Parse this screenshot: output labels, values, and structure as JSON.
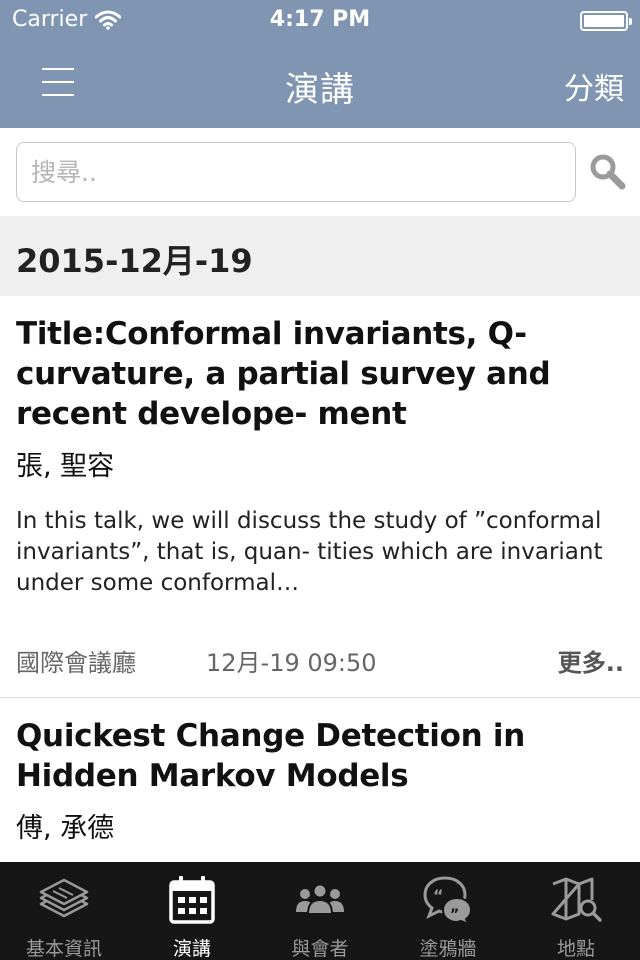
{
  "status_bar": {
    "carrier": "Carrier",
    "time": "4:17 PM"
  },
  "nav": {
    "title": "演講",
    "category_label": "分類"
  },
  "search": {
    "placeholder": "搜尋.."
  },
  "list": {
    "date": "2015-12月-19",
    "items": [
      {
        "title": "Title:Conformal invariants, Q-curvature, a partial survey and recent develope- ment",
        "speaker": "張, 聖容",
        "abstract": "In this talk, we will discuss the study of ”conformal invariants”, that is, quan- tities which are invariant under some conformal…",
        "location": "國際會議廳",
        "time": "12月-19 09:50",
        "more_label": "更多.."
      },
      {
        "title": "Quickest Change Detection in Hidden Markov Models",
        "speaker": "傅, 承德"
      }
    ]
  },
  "tabs": [
    {
      "label": "基本資訊",
      "icon": "newspaper-icon",
      "active": false
    },
    {
      "label": "演講",
      "icon": "calendar-icon",
      "active": true
    },
    {
      "label": "與會者",
      "icon": "people-icon",
      "active": false
    },
    {
      "label": "塗鴉牆",
      "icon": "chat-bubbles-icon",
      "active": false
    },
    {
      "label": "地點",
      "icon": "map-icon",
      "active": false
    }
  ],
  "colors": {
    "header_bg": "#7f95b2",
    "tab_bar_bg": "#161616",
    "date_header_bg": "#efefef"
  }
}
